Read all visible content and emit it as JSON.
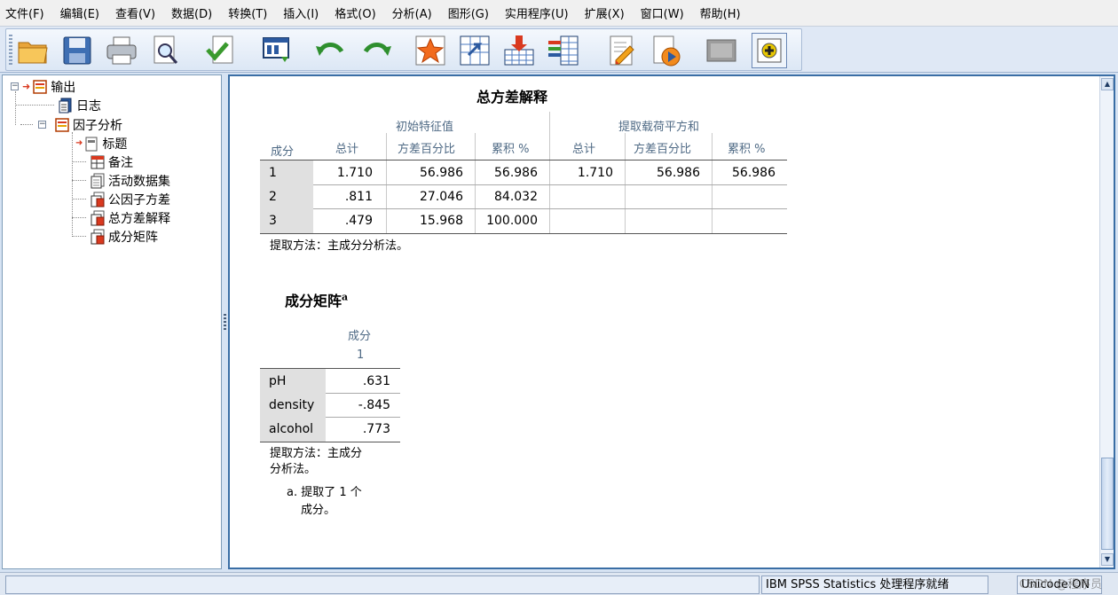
{
  "menu": [
    "文件(F)",
    "编辑(E)",
    "查看(V)",
    "数据(D)",
    "转换(T)",
    "插入(I)",
    "格式(O)",
    "分析(A)",
    "图形(G)",
    "实用程序(U)",
    "扩展(X)",
    "窗口(W)",
    "帮助(H)"
  ],
  "toolbar": {
    "icons": [
      "open-folder-icon",
      "save-icon",
      "print-icon",
      "print-preview-icon",
      "export-icon",
      "recall-dialog-icon",
      "undo-icon",
      "redo-icon",
      "goto-data-icon",
      "goto-case-icon",
      "insert-variable-icon",
      "variables-icon",
      "designate-window-icon",
      "run-script-icon",
      "hide-icon",
      "promote-icon"
    ]
  },
  "tree": {
    "root": "输出",
    "log": "日志",
    "factor_analysis": "因子分析",
    "children": [
      "标题",
      "备注",
      "活动数据集",
      "公因子方差",
      "总方差解释",
      "成分矩阵"
    ]
  },
  "variance_table": {
    "title": "总方差解释",
    "group_initial": "初始特征值",
    "group_extract": "提取载荷平方和",
    "col_component": "成分",
    "cols": [
      "总计",
      "方差百分比",
      "累积 %",
      "总计",
      "方差百分比",
      "累积 %"
    ],
    "rows": [
      {
        "label": "1",
        "cells": [
          "1.710",
          "56.986",
          "56.986",
          "1.710",
          "56.986",
          "56.986"
        ]
      },
      {
        "label": "2",
        "cells": [
          ".811",
          "27.046",
          "84.032",
          "",
          "",
          ""
        ]
      },
      {
        "label": "3",
        "cells": [
          ".479",
          "15.968",
          "100.000",
          "",
          "",
          ""
        ]
      }
    ],
    "footnote": "提取方法：主成分分析法。"
  },
  "component_matrix": {
    "title": "成分矩阵",
    "title_sup": "a",
    "head": "成分",
    "subhead": "1",
    "rows": [
      {
        "label": "pH",
        "value": ".631"
      },
      {
        "label": "density",
        "value": "-.845"
      },
      {
        "label": "alcohol",
        "value": ".773"
      }
    ],
    "footnote_line1": "提取方法：主成分",
    "footnote_line2": "分析法。",
    "note_line1": "a. 提取了 1 个",
    "note_line2": "成分。"
  },
  "status": {
    "processor": "IBM SPSS Statistics 处理程序就绪",
    "unicode": "Unicode:ON",
    "watermark": "CSDN @程序员"
  }
}
